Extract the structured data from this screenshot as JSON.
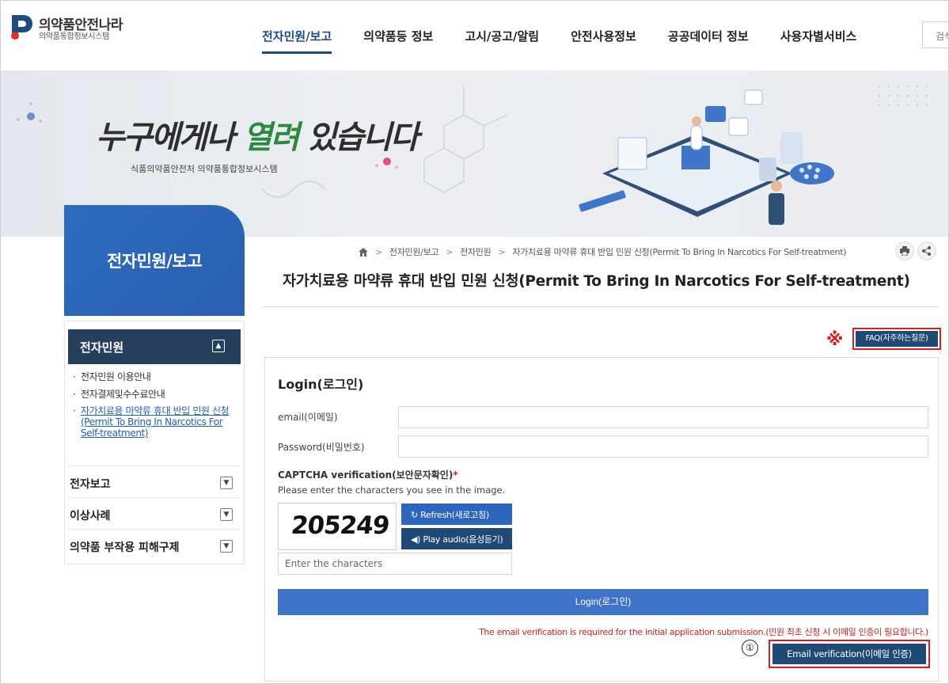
{
  "brand": {
    "title": "의약품안전나라",
    "subtitle": "의약품통합정보시스템"
  },
  "gnb": {
    "items": [
      {
        "label": "전자민원/보고",
        "active": true
      },
      {
        "label": "의약품등 정보",
        "active": false
      },
      {
        "label": "고시/공고/알림",
        "active": false
      },
      {
        "label": "안전사용정보",
        "active": false
      },
      {
        "label": "공공데이터 정보",
        "active": false
      },
      {
        "label": "사용자별서비스",
        "active": false
      }
    ],
    "search_label": "검색"
  },
  "banner": {
    "slogan_a": "누구에게나 ",
    "slogan_b": "열려",
    "slogan_c": " 있습니다",
    "sub": "식품의약품안전처 의약품통합정보시스템"
  },
  "sidebar": {
    "heading": "전자민원/보고",
    "active_category": "전자민원",
    "sub_items": [
      "전자민원 이용안내",
      "전자결제및수수료안내",
      "자가치료용 마약류 휴대 반입 민원 신청(Permit To Bring In Narcotics For Self-treatment)"
    ],
    "categories": [
      "전자보고",
      "이상사례",
      "의약품 부작용 피해구제"
    ]
  },
  "breadcrumb": {
    "items": [
      "전자민원/보고",
      "전자민원",
      "자가치료용 마약류 휴대 반입 민원 신청(Permit To Bring In Narcotics For Self-treatment)"
    ]
  },
  "page": {
    "title": "자가치료용 마약류 휴대 반입 민원 신청(Permit To Bring In Narcotics For Self-treatment)"
  },
  "faq": {
    "mark": "※",
    "label": "FAQ(자주하는질문)"
  },
  "login": {
    "title": "Login(로그인)",
    "email_label": "email(이메일)",
    "email_value": "",
    "password_label": "Password(비밀번호)",
    "password_value": "",
    "captcha_title": "CAPTCHA verification(보안문자확인)",
    "captcha_required": "*",
    "captcha_help": "Please enter the characters you see in the image.",
    "captcha_code": "205249",
    "refresh_label": "Refresh(새로고침)",
    "audio_label": "Play audio(음성듣기)",
    "captcha_placeholder": "Enter the characters",
    "login_button": "Login(로그인)",
    "notice": "The email verification is required for the initial application submission.(민원 최초 신청 시 이메일 인증이 필요합니다.)",
    "step_number": "①",
    "email_verify_button": "Email verification(이메일 인증)"
  },
  "colors": {
    "primary": "#1d4c84",
    "accent_blue": "#2d66bd",
    "dark_navy": "#1f4a76",
    "highlight_red": "#d61f1f"
  }
}
